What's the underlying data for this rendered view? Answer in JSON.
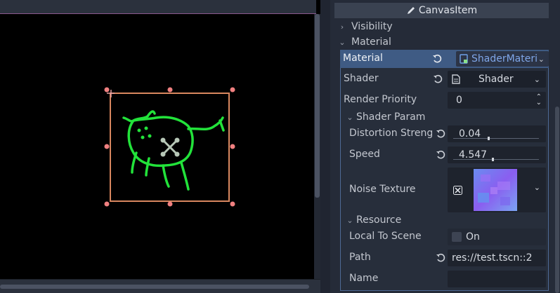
{
  "inspector": {
    "section_title": "CanvasItem",
    "visibility_label": "Visibility",
    "material_group_label": "Material",
    "material": {
      "label": "Material",
      "resource_name": "ShaderMateri"
    },
    "shader": {
      "label": "Shader",
      "value": "Shader"
    },
    "render_priority": {
      "label": "Render Priority",
      "value": "0"
    },
    "shader_param_label": "Shader Param",
    "distortion": {
      "label": "Distortion Streng",
      "value": "0.04",
      "fraction": 0.4
    },
    "speed": {
      "label": "Speed",
      "value": "4.547",
      "fraction": 0.45
    },
    "noise_texture": {
      "label": "Noise Texture"
    },
    "resource_label": "Resource",
    "local_to_scene": {
      "label": "Local To Scene",
      "value": "On"
    },
    "path": {
      "label": "Path",
      "value": "res://test.tscn::2"
    },
    "name": {
      "label": "Name",
      "value": ""
    }
  },
  "colors": {
    "selection_box": "#d9875f",
    "handle": "#f08080",
    "sprite_stroke": "#22e23a",
    "accent_blue": "#3f5b84"
  }
}
